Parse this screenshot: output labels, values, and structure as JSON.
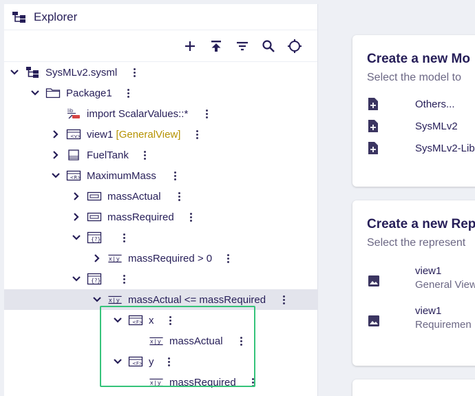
{
  "explorer": {
    "title": "Explorer",
    "toolbar": {
      "new_icon": "plus-icon",
      "upload_icon": "upload-icon",
      "filter_icon": "filter-icon",
      "search_icon": "search-icon",
      "reveal_icon": "crosshair-icon"
    },
    "tree": [
      {
        "label": "SysMLv2.sysml",
        "icon": "model-icon",
        "expanded": true
      },
      {
        "label": "Package1",
        "icon": "folder-icon",
        "expanded": true
      },
      {
        "label": "import ScalarValues::*",
        "icon": "import-icon"
      },
      {
        "label": "view1",
        "tag": "[GeneralView]",
        "icon": "view-icon",
        "expanded": false
      },
      {
        "label": "FuelTank",
        "icon": "part-icon",
        "expanded": false
      },
      {
        "label": "MaximumMass",
        "icon": "requirement-def-icon",
        "expanded": true
      },
      {
        "label": "massActual",
        "icon": "attribute-icon",
        "expanded": false
      },
      {
        "label": "massRequired",
        "icon": "attribute-icon",
        "expanded": false
      },
      {
        "label": "",
        "icon": "constraint-icon",
        "expanded": true
      },
      {
        "label": "massRequired > 0",
        "icon": "expression-icon",
        "expanded": false
      },
      {
        "label": "",
        "icon": "constraint-icon",
        "expanded": true
      },
      {
        "label": "massActual <= massRequired",
        "icon": "expression-icon",
        "expanded": true,
        "selected": true
      },
      {
        "label": "x",
        "icon": "feature-icon",
        "expanded": true
      },
      {
        "label": "massActual",
        "icon": "expression-icon"
      },
      {
        "label": "y",
        "icon": "feature-icon",
        "expanded": true
      },
      {
        "label": "massRequired",
        "icon": "expression-icon"
      }
    ]
  },
  "create_model": {
    "title": "Create a new Mo",
    "subtitle": "Select the model to",
    "items": [
      "Others...",
      "SysMLv2",
      "SysMLv2-Lib"
    ]
  },
  "create_representation": {
    "title": "Create a new Rep",
    "subtitle": "Select the represent",
    "items": [
      {
        "name": "view1",
        "type": "General View"
      },
      {
        "name": "view1",
        "type": "Requiremen"
      }
    ]
  },
  "colors": {
    "text": "#261e58",
    "tag": "#b59200",
    "selection": "#e3e4ec",
    "highlight_border": "#35c37a"
  }
}
